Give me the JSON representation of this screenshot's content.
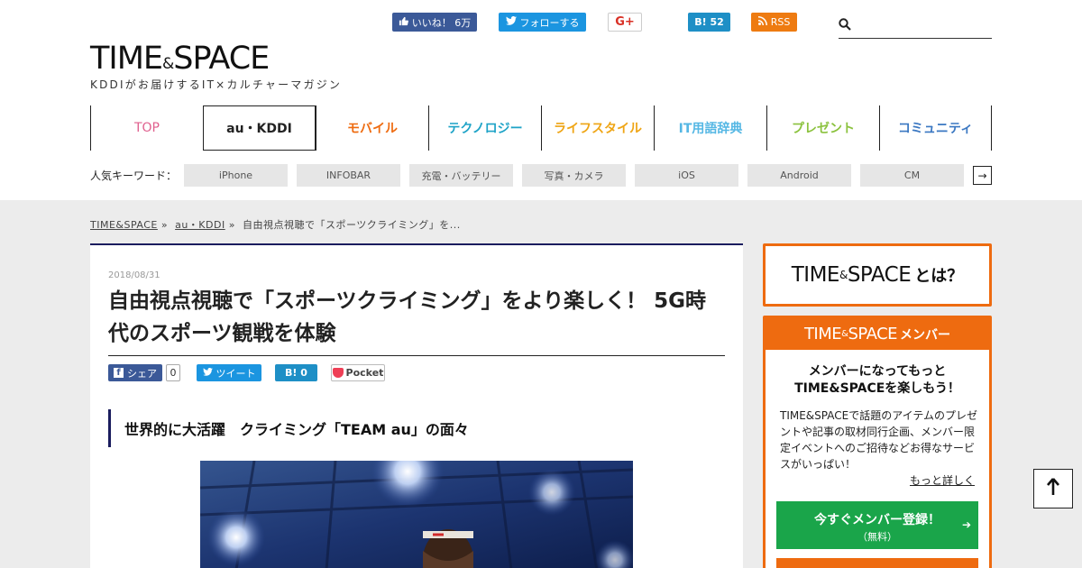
{
  "social": {
    "facebook": "いいね！ 6万",
    "twitter": "フォローする",
    "googleplus": "G+",
    "hatena": "B! 52",
    "rss": "RSS"
  },
  "search": {
    "placeholder": ""
  },
  "logo": {
    "main_left": "TIME",
    "amp": "&",
    "main_right": "SPACE",
    "tagline": "KDDIがお届けするIT×カルチャーマガジン"
  },
  "gnav": [
    {
      "label": "TOP",
      "color": "#e0608e"
    },
    {
      "label": "au・KDDI",
      "color": "#222222"
    },
    {
      "label": "モバイル",
      "color": "#ee6b10"
    },
    {
      "label": "テクノロジー",
      "color": "#1ea3c7"
    },
    {
      "label": "ライフスタイル",
      "color": "#efa515"
    },
    {
      "label": "IT用語辞典",
      "color": "#55b7e4"
    },
    {
      "label": "プレゼント",
      "color": "#8bc23e"
    },
    {
      "label": "コミュニティ",
      "color": "#3b78c2"
    }
  ],
  "keywords": {
    "label": "人気キーワード：",
    "items": [
      "iPhone",
      "INFOBAR",
      "充電・バッテリー",
      "写真・カメラ",
      "iOS",
      "Android",
      "CM"
    ],
    "more": "→"
  },
  "breadcrumb": {
    "home": "TIME&SPACE",
    "category": "au・KDDI",
    "current": "自由視点視聴で「スポーツクライミング」を...",
    "sep": "»"
  },
  "article": {
    "date": "2018/08/31",
    "title": "自由視点視聴で「スポーツクライミング」をより楽しく！ 5G時代のスポーツ観戦を体験",
    "share": {
      "facebook": "シェア",
      "facebook_count": "0",
      "twitter": "ツイート",
      "hatena": "B!  0",
      "pocket": "Pocket"
    },
    "heading": "世界的に大活躍　クライミング「TEAM au」の面々"
  },
  "sidebar": {
    "about": {
      "logo_left": "TIME",
      "amp": "&",
      "logo_right": "SPACE",
      "suffix": "とは？"
    },
    "member": {
      "head_left": "TIME",
      "head_amp": "&",
      "head_right": "SPACE",
      "head_suffix": "メンバー",
      "catch_line1": "メンバーになってもっと",
      "catch_line2": "TIME&SPACEを楽しもう！",
      "desc": "TIME&SPACEで話題のアイテムのプレゼントや記事の取材同行企画、メンバー限定イベントへのご招待などお得なサービスがいっぱい！",
      "more": "もっと詳しく",
      "register_label": "今すぐメンバー登録！",
      "register_sub": "（無料）",
      "register_arrow": "➔"
    }
  },
  "totop": {
    "label": "↑"
  }
}
